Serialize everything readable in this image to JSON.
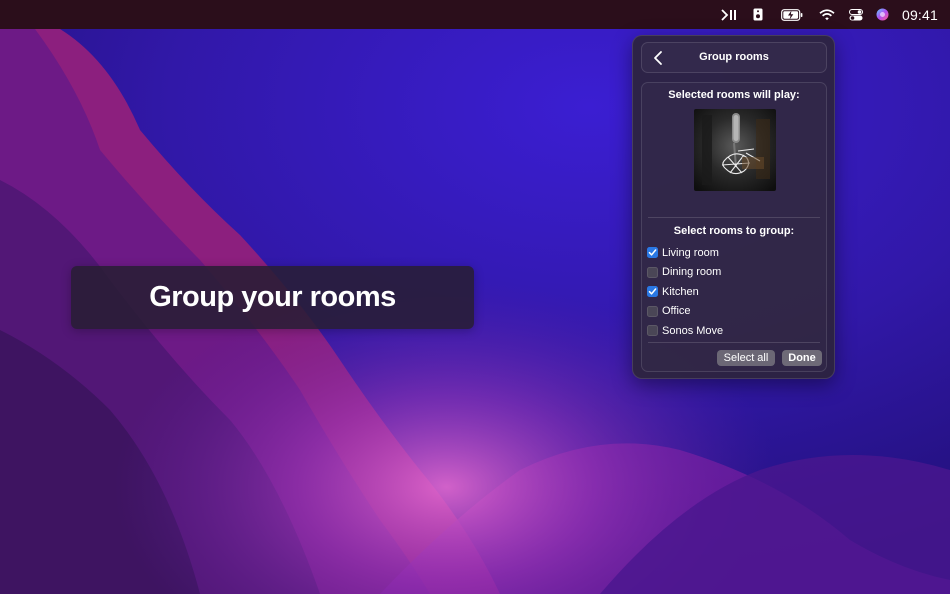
{
  "menubar": {
    "icons": [
      "play-pause-icon",
      "speaker-icon",
      "battery-charging-icon",
      "wifi-icon",
      "control-center-icon",
      "siri-icon"
    ],
    "clock": "09:41"
  },
  "caption": {
    "text": "Group your rooms"
  },
  "popover": {
    "title": "Group rooms",
    "back_icon": "chevron-left-icon",
    "playing_title": "Selected rooms will play:",
    "artwork_icon": "microphone-artwork-icon",
    "select_title": "Select rooms to group:",
    "rooms": [
      {
        "label": "Living room",
        "checked": true
      },
      {
        "label": "Dining room",
        "checked": false
      },
      {
        "label": "Kitchen",
        "checked": true
      },
      {
        "label": "Office",
        "checked": false
      },
      {
        "label": "Sonos Move",
        "checked": false
      }
    ],
    "select_all_label": "Select all",
    "done_label": "Done"
  },
  "colors": {
    "menubar_bg": "#2b0e1b",
    "checkbox_checked": "#2a78e4",
    "wallpaper_blue": "#3a20c8",
    "wallpaper_magenta": "#a2197a"
  }
}
